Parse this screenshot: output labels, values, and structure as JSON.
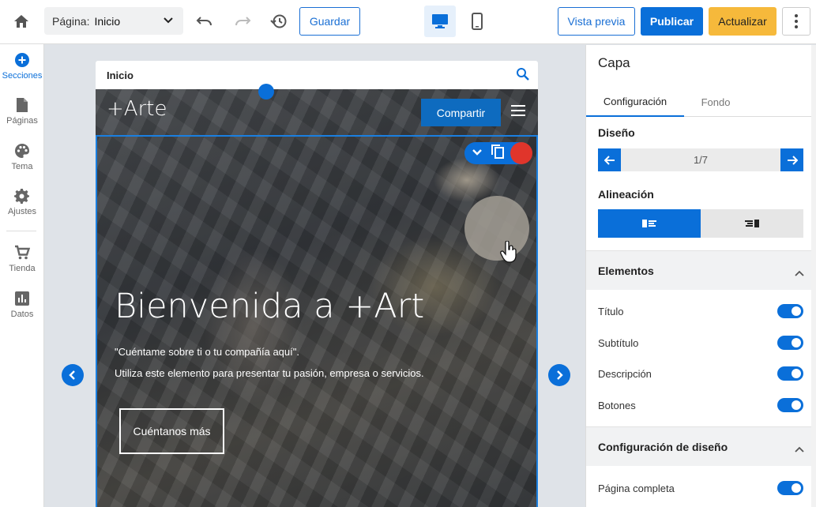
{
  "topbar": {
    "page_label": "Página:",
    "page_value": "Inicio",
    "save_label": "Guardar",
    "preview_label": "Vista previa",
    "publish_label": "Publicar",
    "update_label": "Actualizar"
  },
  "rail": {
    "items": [
      {
        "label": "Secciones",
        "icon": "plus-circle-icon"
      },
      {
        "label": "Páginas",
        "icon": "page-icon"
      },
      {
        "label": "Tema",
        "icon": "palette-icon"
      },
      {
        "label": "Ajustes",
        "icon": "gear-icon"
      },
      {
        "label": "Tienda",
        "icon": "cart-icon"
      },
      {
        "label": "Datos",
        "icon": "chart-icon"
      }
    ]
  },
  "preview": {
    "page_name": "Inicio",
    "logo": "+Arte",
    "share_label": "Compartir",
    "title": "Bienvenida a +Art",
    "subtitle": "\"Cuéntame sobre ti o tu compañía aquí\".",
    "description": "Utiliza este elemento para presentar tu pasión, empresa o servicios.",
    "button_label": "Cuéntanos más"
  },
  "panel": {
    "title": "Capa",
    "tabs": [
      "Configuración",
      "Fondo"
    ],
    "design_label": "Diseño",
    "design_counter": "1/7",
    "alignment_label": "Alineación",
    "elements_header": "Elementos",
    "elements": [
      {
        "label": "Título",
        "on": true
      },
      {
        "label": "Subtítulo",
        "on": true
      },
      {
        "label": "Descripción",
        "on": true
      },
      {
        "label": "Botones",
        "on": true
      }
    ],
    "layout_header": "Configuración de diseño",
    "layout_items": [
      {
        "label": "Página completa",
        "on": true
      }
    ]
  },
  "colors": {
    "accent": "#0a6fd9",
    "update": "#f6b93b",
    "share": "#0e6bbf"
  }
}
